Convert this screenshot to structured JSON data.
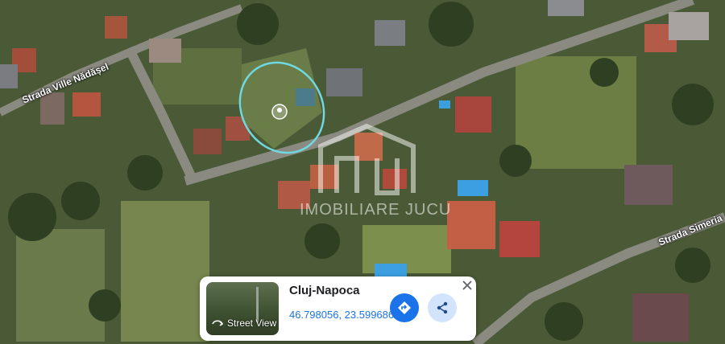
{
  "map": {
    "roads": [
      "Strada Ville Nădășel",
      "Strada Simeria"
    ]
  },
  "watermark": {
    "text": "IMOBILIARE JUCU"
  },
  "place_card": {
    "city": "Cluj-Napoca",
    "coordinates": "46.798056, 23.599686",
    "street_view_label": "Street View"
  },
  "icons": [
    "pin-icon",
    "street-view-icon",
    "directions-icon",
    "share-icon",
    "close-icon"
  ],
  "colors": {
    "highlight": "#6fd8e0",
    "accent": "#1a73e8",
    "share_bg": "#d2e3fc"
  }
}
